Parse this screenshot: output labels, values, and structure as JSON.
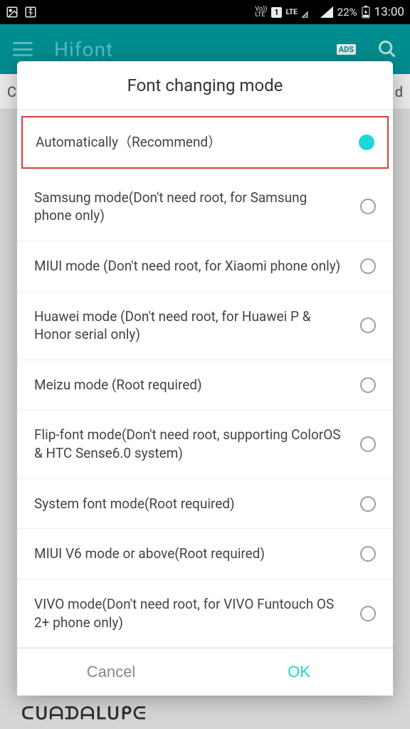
{
  "status": {
    "volte": "Vo))\nLTE",
    "sim": "1",
    "lte": "LTE",
    "battery": "22%",
    "time": "13:00"
  },
  "header": {
    "title": "Hifont",
    "ads": "ADS"
  },
  "catbar": {
    "left": "C",
    "right": "d"
  },
  "dialog": {
    "title": "Font changing mode",
    "options": [
      {
        "label": "Automatically（Recommend）",
        "selected": true,
        "highlight": true
      },
      {
        "label": "Samsung mode(Don't need root, for Samsung phone only)",
        "selected": false
      },
      {
        "label": "MIUI mode (Don't need root, for Xiaomi phone only)",
        "selected": false
      },
      {
        "label": "Huawei mode (Don't need root, for Huawei P & Honor serial only)",
        "selected": false
      },
      {
        "label": "Meizu mode (Root required)",
        "selected": false
      },
      {
        "label": "Flip-font mode(Don't need root, supporting ColorOS & HTC Sense6.0 system)",
        "selected": false
      },
      {
        "label": "System font mode(Root required)",
        "selected": false
      },
      {
        "label": "MIUI V6 mode or above(Root required)",
        "selected": false
      },
      {
        "label": "VIVO mode(Don't need root, for VIVO Funtouch OS 2+ phone only)",
        "selected": false
      }
    ],
    "cancel": "Cancel",
    "ok": "OK"
  },
  "peek": {
    "left": "ᑕᑌᗩᗪᗩᒪᑌᑭᕮ",
    "right": ""
  }
}
